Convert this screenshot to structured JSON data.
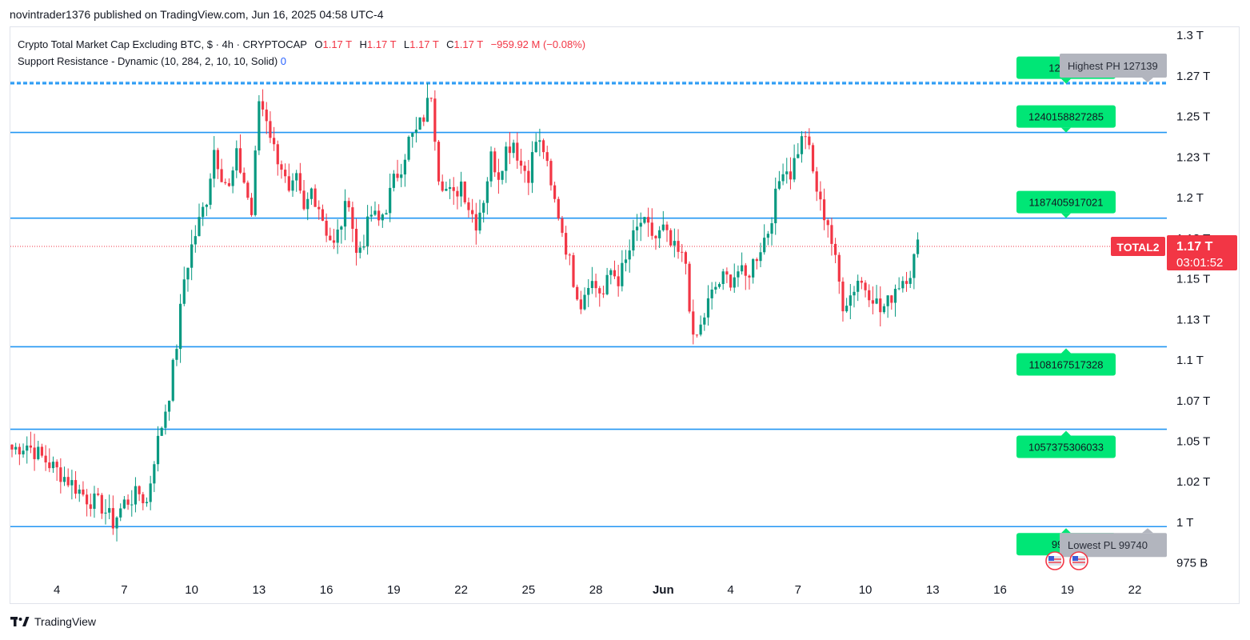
{
  "publish_line": "novintrader1376 published on TradingView.com, Jun 16, 2025 04:58 UTC-4",
  "legend": {
    "symbol_line": "Crypto Total Market Cap Excluding BTC, $ · 4h · CRYPTOCAP",
    "o_label": "O",
    "o_value": "1.17 T",
    "h_label": "H",
    "h_value": "1.17 T",
    "l_label": "L",
    "l_value": "1.17 T",
    "c_label": "C",
    "c_value": "1.17 T",
    "change": "−959.92 M (−0.08%)",
    "indicator": "Support Resistance - Dynamic (10, 284, 2, 10, 10, Solid)",
    "indicator_value": "0"
  },
  "footer": {
    "brand": "TradingView"
  },
  "colors": {
    "up": "#089981",
    "down": "#f23645",
    "level": "#2196f3",
    "label_green": "#00e676",
    "label_gray": "#b2b5be"
  },
  "chart_data": {
    "type": "candlestick",
    "ticker_label": "TOTAL2",
    "last_price_label": "1.17 T",
    "countdown": "03:01:52",
    "last_price": 1.17,
    "y_axis": {
      "unit": "T",
      "ylim": [
        0.965,
        1.305
      ],
      "ticks": [
        "1.3 T",
        "1.27 T",
        "1.25 T",
        "1.23 T",
        "1.2 T",
        "1.18 T",
        "1.15 T",
        "1.13 T",
        "1.1 T",
        "1.07 T",
        "1.05 T",
        "1.02 T",
        "1 T",
        "975 B"
      ],
      "tick_values": [
        1.3,
        1.275,
        1.25,
        1.225,
        1.2,
        1.175,
        1.15,
        1.125,
        1.1,
        1.075,
        1.05,
        1.025,
        1.0,
        0.975
      ]
    },
    "x_axis": {
      "labels": [
        "4",
        "7",
        "10",
        "13",
        "16",
        "19",
        "22",
        "25",
        "28",
        "Jun",
        "4",
        "7",
        "10",
        "13",
        "16",
        "19",
        "22"
      ],
      "label_index": [
        12,
        30,
        48,
        66,
        84,
        102,
        120,
        138,
        156,
        174,
        192,
        210,
        228,
        246,
        264,
        282,
        300
      ]
    },
    "levels": [
      {
        "value": 1.27018,
        "label": "127018",
        "style": "dashed"
      },
      {
        "value": 1.271,
        "label": "",
        "style": "dashed"
      },
      {
        "value": 1.240158827285,
        "label": "1240158827285",
        "style": "solid"
      },
      {
        "value": 1.187405917021,
        "label": "1187405917021",
        "style": "solid"
      },
      {
        "value": 1.108167517328,
        "label": "1108167517328",
        "style": "solid"
      },
      {
        "value": 1.057375306033,
        "label": "1057375306033",
        "style": "solid"
      },
      {
        "value": 0.9974,
        "label": "99740",
        "style": "solid"
      }
    ],
    "annotations": [
      {
        "text": "Highest PH 127139",
        "value": 1.271
      },
      {
        "text": "Lowest PL 99740",
        "value": 0.9974
      }
    ],
    "candles": {
      "anchors": [
        [
          0,
          1.045
        ],
        [
          4,
          1.048
        ],
        [
          8,
          1.04
        ],
        [
          12,
          1.032
        ],
        [
          16,
          1.024
        ],
        [
          20,
          1.015
        ],
        [
          24,
          1.01
        ],
        [
          27,
          1.0
        ],
        [
          30,
          1.012
        ],
        [
          34,
          1.018
        ],
        [
          36,
          1.012
        ],
        [
          38,
          1.04
        ],
        [
          40,
          1.06
        ],
        [
          42,
          1.08
        ],
        [
          44,
          1.11
        ],
        [
          46,
          1.15
        ],
        [
          48,
          1.17
        ],
        [
          50,
          1.185
        ],
        [
          52,
          1.2
        ],
        [
          54,
          1.23
        ],
        [
          56,
          1.215
        ],
        [
          58,
          1.205
        ],
        [
          60,
          1.225
        ],
        [
          62,
          1.21
        ],
        [
          64,
          1.19
        ],
        [
          66,
          1.26
        ],
        [
          68,
          1.25
        ],
        [
          70,
          1.23
        ],
        [
          72,
          1.22
        ],
        [
          74,
          1.2
        ],
        [
          76,
          1.21
        ],
        [
          78,
          1.19
        ],
        [
          80,
          1.205
        ],
        [
          82,
          1.195
        ],
        [
          84,
          1.18
        ],
        [
          86,
          1.17
        ],
        [
          88,
          1.185
        ],
        [
          90,
          1.2
        ],
        [
          92,
          1.165
        ],
        [
          94,
          1.175
        ],
        [
          96,
          1.19
        ],
        [
          98,
          1.185
        ],
        [
          100,
          1.195
        ],
        [
          102,
          1.21
        ],
        [
          104,
          1.22
        ],
        [
          106,
          1.235
        ],
        [
          108,
          1.24
        ],
        [
          110,
          1.25
        ],
        [
          112,
          1.265
        ],
        [
          114,
          1.215
        ],
        [
          116,
          1.205
        ],
        [
          118,
          1.2
        ],
        [
          120,
          1.21
        ],
        [
          122,
          1.195
        ],
        [
          124,
          1.185
        ],
        [
          126,
          1.2
        ],
        [
          128,
          1.225
        ],
        [
          130,
          1.215
        ],
        [
          132,
          1.23
        ],
        [
          134,
          1.235
        ],
        [
          136,
          1.22
        ],
        [
          138,
          1.215
        ],
        [
          140,
          1.235
        ],
        [
          142,
          1.23
        ],
        [
          144,
          1.205
        ],
        [
          146,
          1.19
        ],
        [
          148,
          1.17
        ],
        [
          150,
          1.15
        ],
        [
          152,
          1.135
        ],
        [
          154,
          1.15
        ],
        [
          156,
          1.145
        ],
        [
          158,
          1.14
        ],
        [
          160,
          1.155
        ],
        [
          162,
          1.15
        ],
        [
          164,
          1.16
        ],
        [
          166,
          1.175
        ],
        [
          168,
          1.185
        ],
        [
          170,
          1.18
        ],
        [
          172,
          1.175
        ],
        [
          174,
          1.18
        ],
        [
          176,
          1.17
        ],
        [
          178,
          1.165
        ],
        [
          180,
          1.16
        ],
        [
          182,
          1.11
        ],
        [
          184,
          1.12
        ],
        [
          186,
          1.135
        ],
        [
          188,
          1.145
        ],
        [
          190,
          1.15
        ],
        [
          192,
          1.15
        ],
        [
          194,
          1.155
        ],
        [
          196,
          1.15
        ],
        [
          198,
          1.16
        ],
        [
          200,
          1.17
        ],
        [
          202,
          1.18
        ],
        [
          204,
          1.2
        ],
        [
          206,
          1.22
        ],
        [
          208,
          1.215
        ],
        [
          210,
          1.23
        ],
        [
          212,
          1.24
        ],
        [
          214,
          1.215
        ],
        [
          216,
          1.195
        ],
        [
          218,
          1.185
        ],
        [
          220,
          1.16
        ],
        [
          222,
          1.135
        ],
        [
          224,
          1.14
        ],
        [
          226,
          1.15
        ],
        [
          228,
          1.145
        ],
        [
          230,
          1.14
        ],
        [
          232,
          1.13
        ],
        [
          234,
          1.135
        ],
        [
          236,
          1.145
        ],
        [
          238,
          1.15
        ],
        [
          240,
          1.155
        ],
        [
          242,
          1.17
        ]
      ]
    }
  }
}
